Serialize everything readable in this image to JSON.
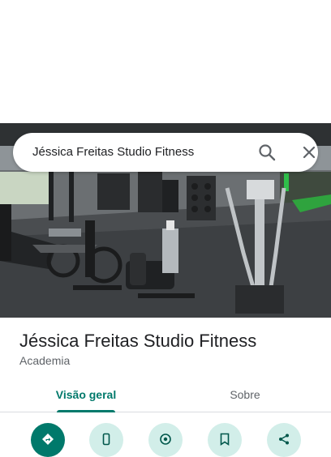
{
  "search": {
    "query": "Jéssica Freitas Studio Fitness"
  },
  "place": {
    "name": "Jéssica Freitas Studio Fitness",
    "category": "Academia"
  },
  "tabs": [
    {
      "label": "Visão geral",
      "selected": true
    },
    {
      "label": "Sobre",
      "selected": false
    }
  ],
  "actions": [
    {
      "icon": "directions-icon"
    },
    {
      "icon": "phone-icon"
    },
    {
      "icon": "nearby-icon"
    },
    {
      "icon": "save-icon"
    },
    {
      "icon": "share-icon"
    }
  ],
  "colors": {
    "accent": "#00796b",
    "accent_light": "#d2eee9",
    "text": "#202124",
    "secondary_text": "#5f6368"
  }
}
